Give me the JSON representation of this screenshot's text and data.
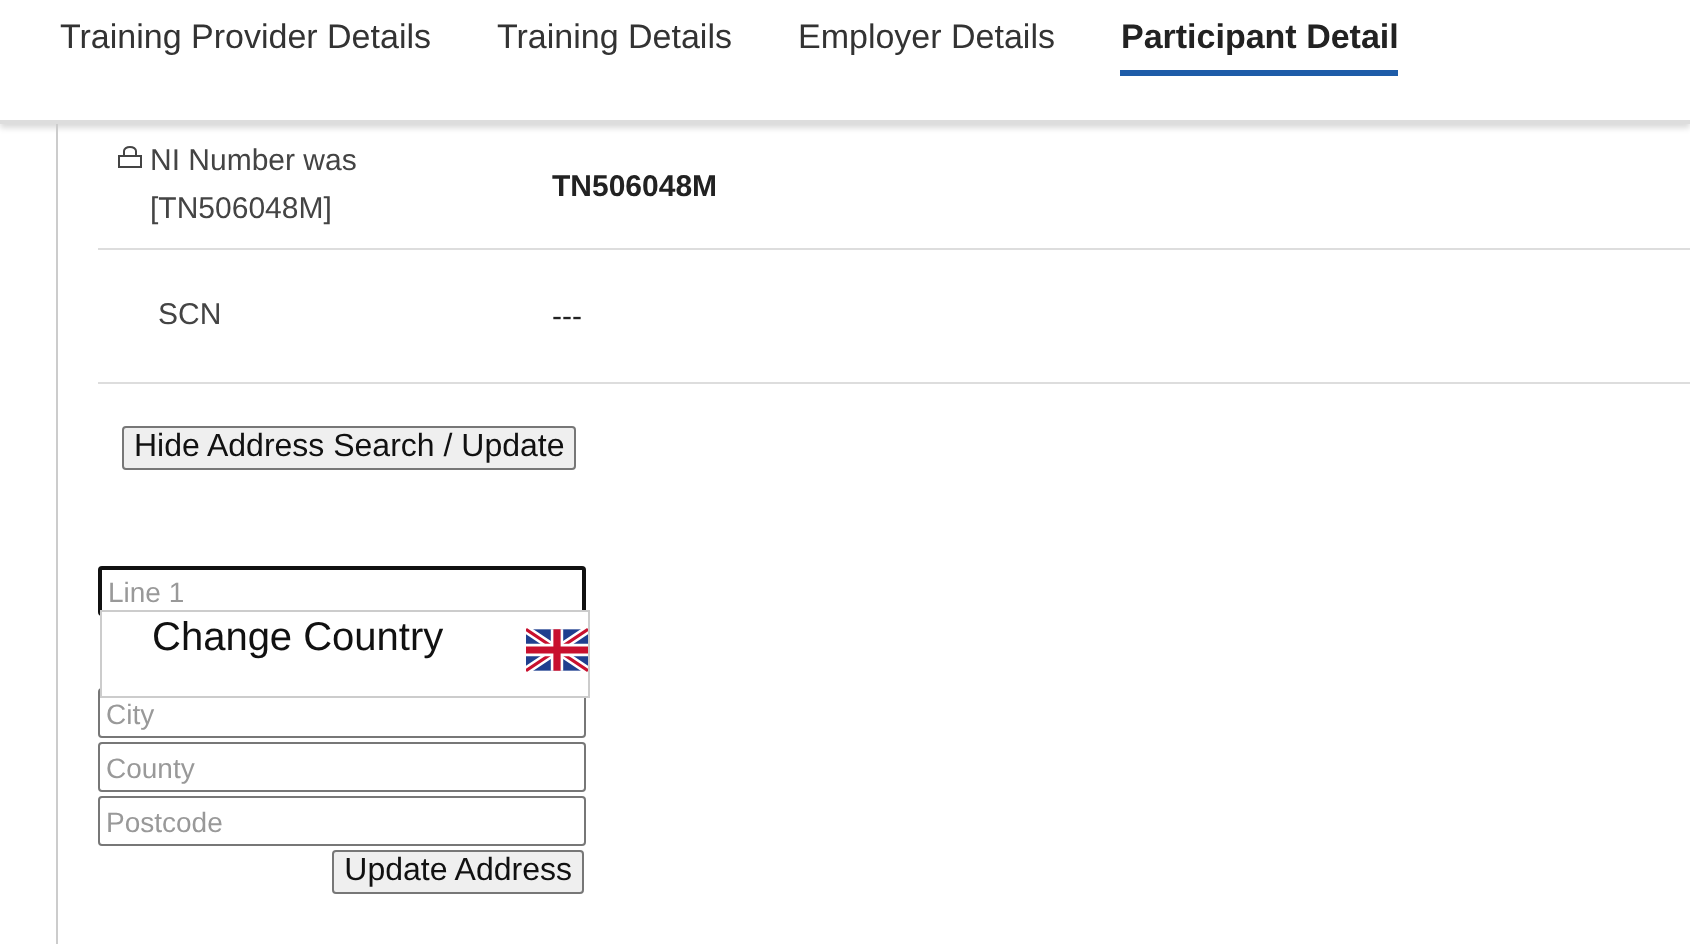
{
  "tabs": [
    {
      "label": "Training Provider Details",
      "selected": false
    },
    {
      "label": "Training Details",
      "selected": false
    },
    {
      "label": "Employer Details",
      "selected": false
    },
    {
      "label": "Participant Detail",
      "selected": true
    }
  ],
  "fields": [
    {
      "label": "NI Number was [TN506048M]",
      "value": "TN506048M",
      "locked": true
    },
    {
      "label": "SCN",
      "value": "---",
      "locked": false
    }
  ],
  "toggle_button": "Hide Address Search / Update",
  "address_inputs": [
    {
      "placeholder": "Line 1",
      "focused": true
    },
    {
      "placeholder": "City",
      "focused": false
    },
    {
      "placeholder": "County",
      "focused": false
    },
    {
      "placeholder": "Postcode",
      "focused": false
    }
  ],
  "country_popup": {
    "label": "Change Country"
  },
  "update_button": "Update Address"
}
